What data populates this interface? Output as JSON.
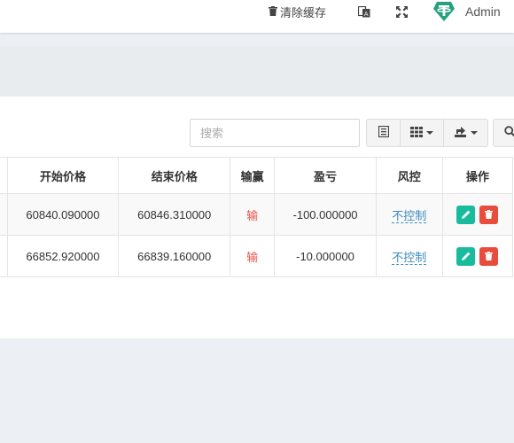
{
  "header": {
    "clear_cache": "清除缓存",
    "admin_name": "Admin",
    "icons": [
      "trash-icon",
      "translate-icon",
      "fullscreen-icon",
      "tether-logo-icon"
    ],
    "avatar_color": "#26a17b"
  },
  "toolbar": {
    "search_placeholder": "搜索",
    "icons": [
      "columns-icon",
      "grid-icon",
      "export-icon",
      "search-icon"
    ]
  },
  "table": {
    "columns": [
      "开始价格",
      "结束价格",
      "输赢",
      "盈亏",
      "风控",
      "操作"
    ],
    "rows": [
      {
        "start": "60840.090000",
        "end": "60846.310000",
        "result": "输",
        "pnl": "-100.000000",
        "risk": "不控制"
      },
      {
        "start": "66852.920000",
        "end": "66839.160000",
        "result": "输",
        "pnl": "-10.000000",
        "risk": "不控制"
      }
    ]
  },
  "colors": {
    "edit": "#18bc9c",
    "delete": "#e74c3c",
    "loss": "#e8534a",
    "link": "#3c8dbc"
  }
}
